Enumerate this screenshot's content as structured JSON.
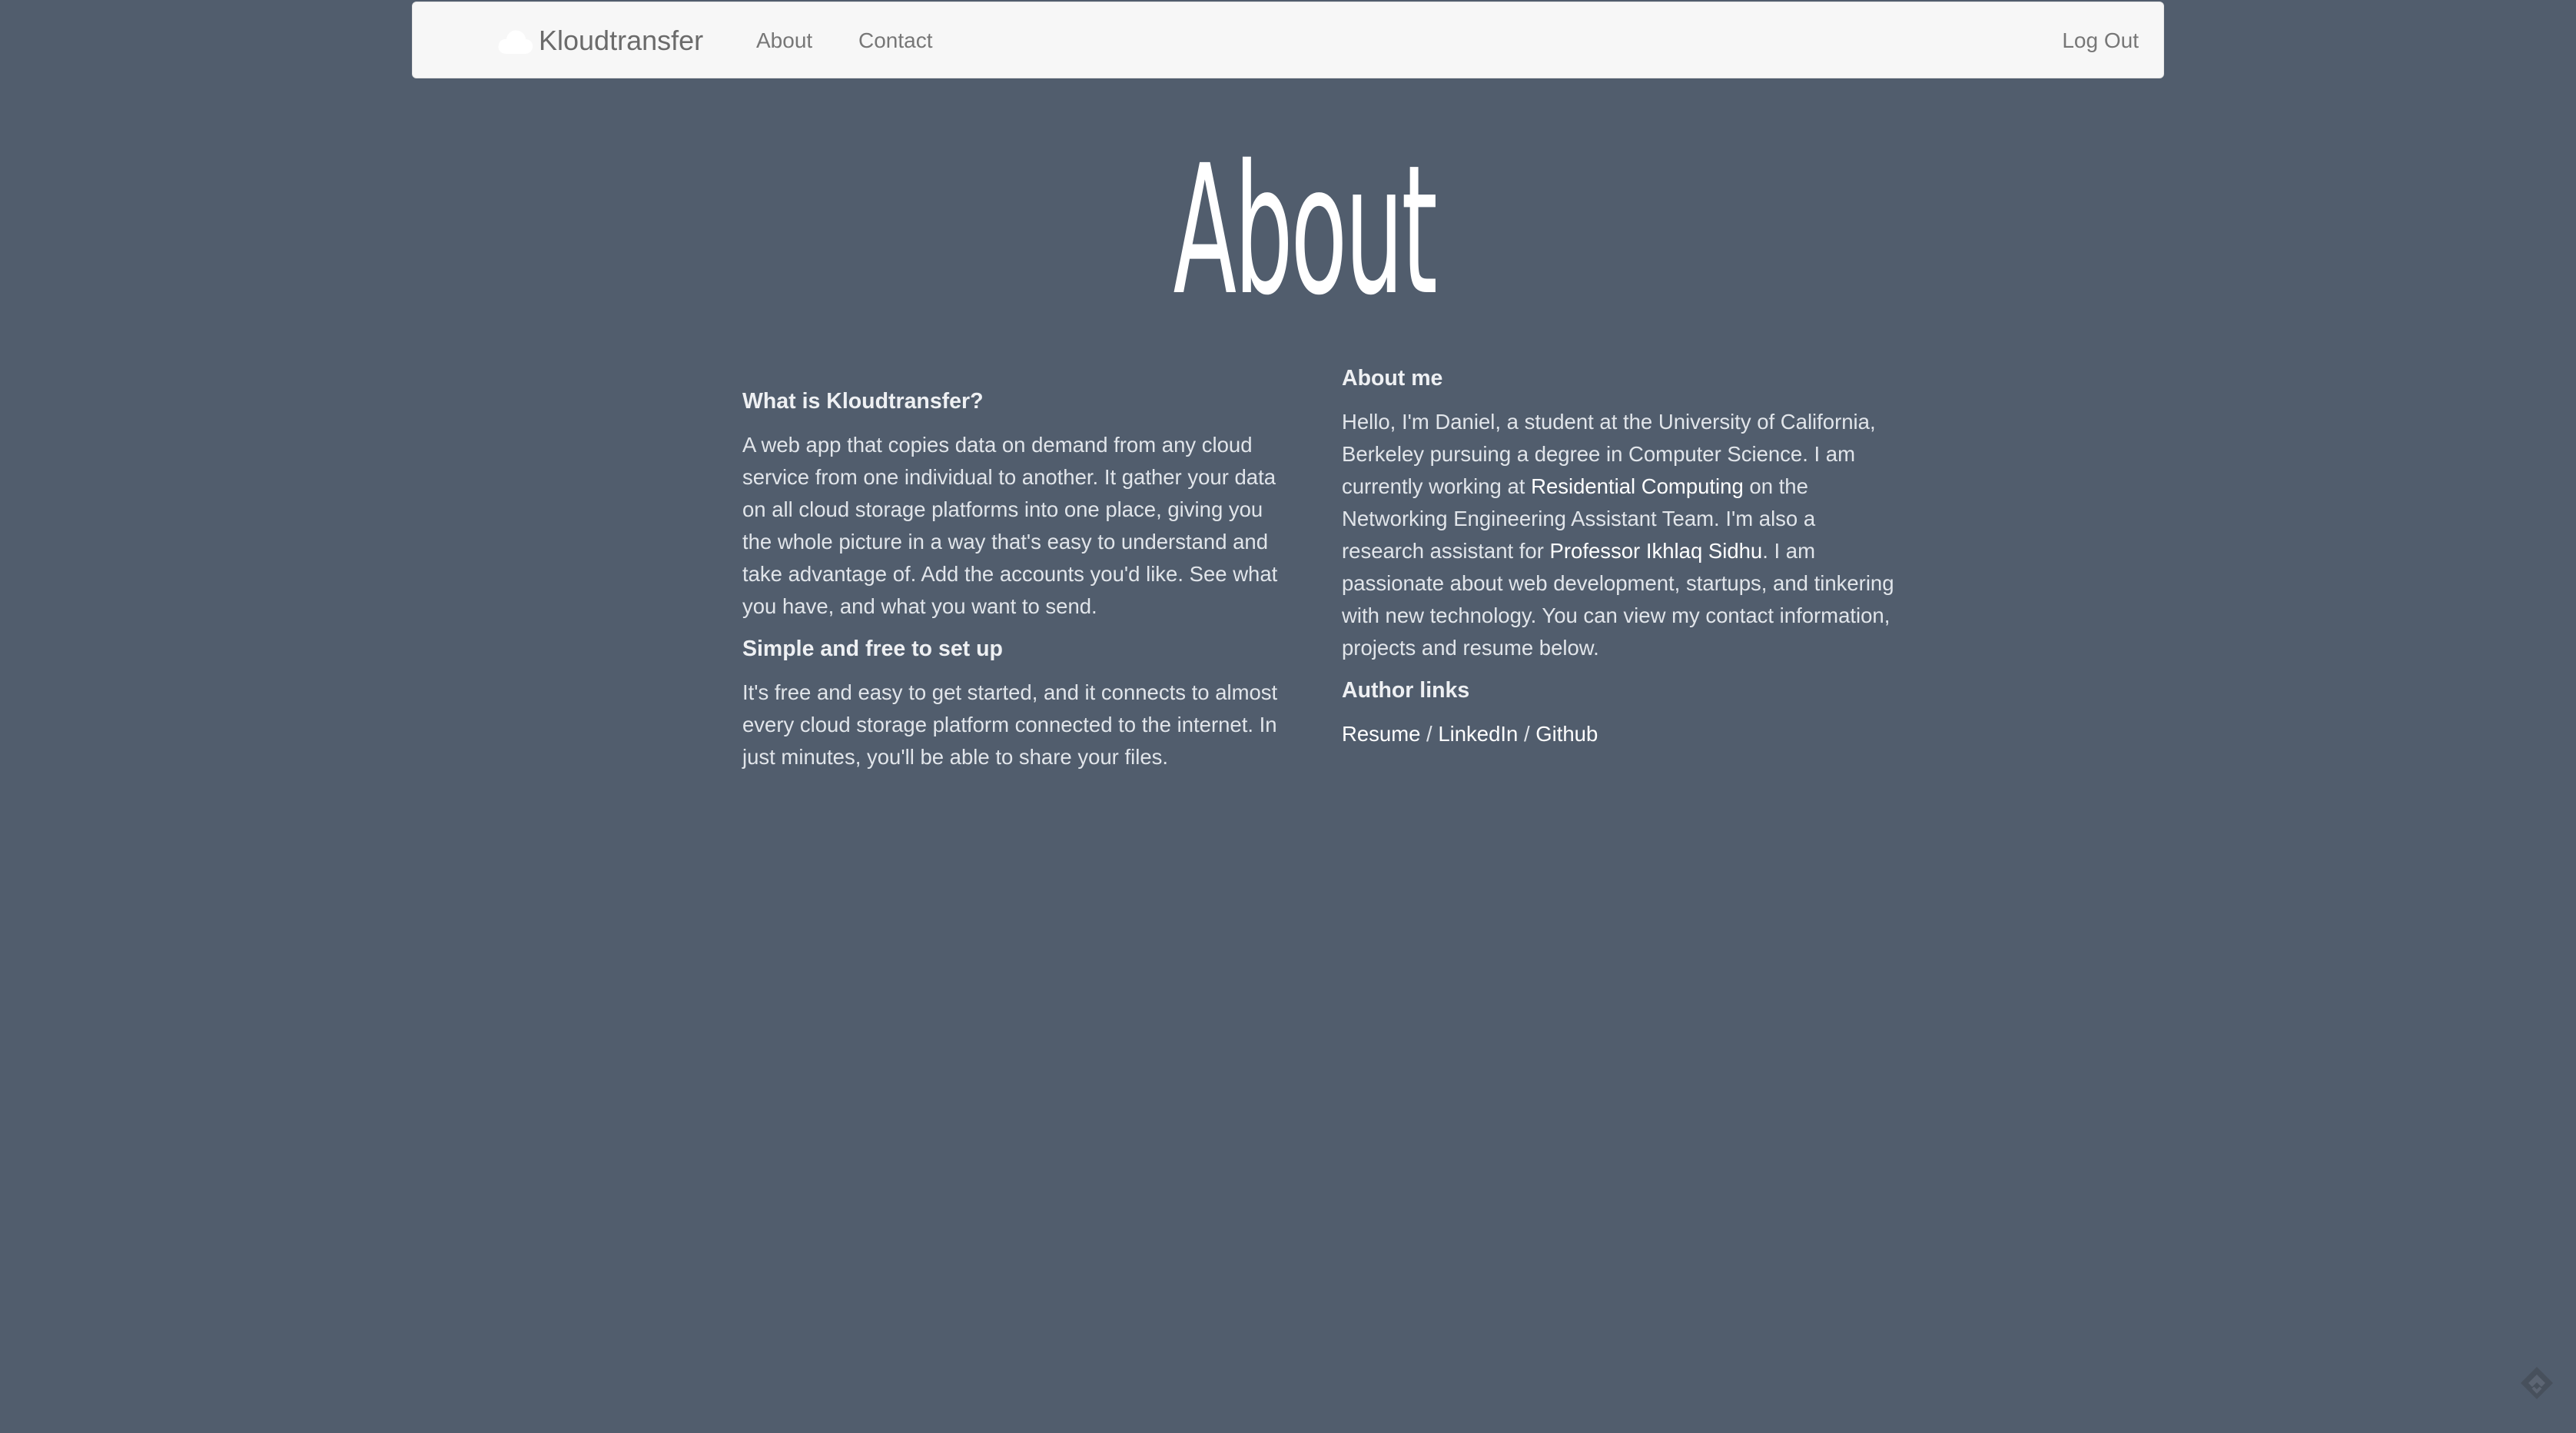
{
  "navbar": {
    "brand": "Kloudtransfer",
    "links": {
      "about": "About",
      "contact": "Contact",
      "logout": "Log Out"
    },
    "icons": {
      "logo": "cloud-icon"
    }
  },
  "page": {
    "title": "About"
  },
  "left_column": {
    "heading1": "What is Kloudtransfer?",
    "para1": "A web app that copies data on demand from any cloud service from one individual to another. It gather your data on all cloud storage platforms into one place, giving you the whole picture in a way that's easy to understand and take advantage of. Add the accounts you'd like. See what you have, and what you want to send.",
    "heading2": "Simple and free to set up",
    "para2": "It's free and easy to get started, and it connects to almost every cloud storage platform connected to the internet. In just minutes, you'll be able to share your files."
  },
  "right_column": {
    "heading1": "About me",
    "para_part1": "Hello, I'm Daniel, a student at the University of California, Berkeley pursuing a degree in Computer Science. I am currently working at ",
    "link_residential": "Residential Computing",
    "para_part2": " on the Networking Engineering Assistant Team. I'm also a research assistant for ",
    "link_professor": "Professor Ikhlaq Sidhu",
    "para_part3": ". I am passionate about web development, startups, and tinkering with new technology. You can view my contact information, projects and resume below.",
    "heading2": "Author links",
    "links": {
      "resume": "Resume",
      "linkedin": "LinkedIn",
      "github": "Github",
      "separator": " / "
    }
  },
  "colors": {
    "background": "#515d6d",
    "navbar": "#f7f7f7",
    "text": "#e1e5ea",
    "link": "#ffffff"
  },
  "icons": {
    "corner": "feedly-icon"
  }
}
